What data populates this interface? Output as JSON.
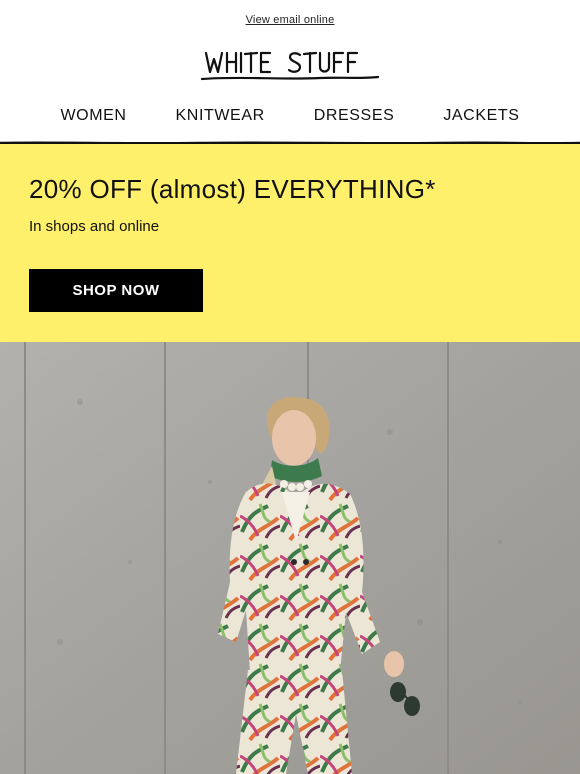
{
  "header": {
    "view_online_label": "View email online",
    "brand": "WHITE STUFF"
  },
  "nav": {
    "items": [
      {
        "label": "WOMEN"
      },
      {
        "label": "KNITWEAR"
      },
      {
        "label": "DRESSES"
      },
      {
        "label": "JACKETS"
      }
    ]
  },
  "promo": {
    "title": "20% OFF (almost) EVERYTHING*",
    "subtitle": "In shops and online",
    "cta_label": "SHOP NOW",
    "background_color": "#fef06b",
    "button_color": "#000000"
  },
  "hero": {
    "image": "model-in-printed-suit-photo"
  }
}
